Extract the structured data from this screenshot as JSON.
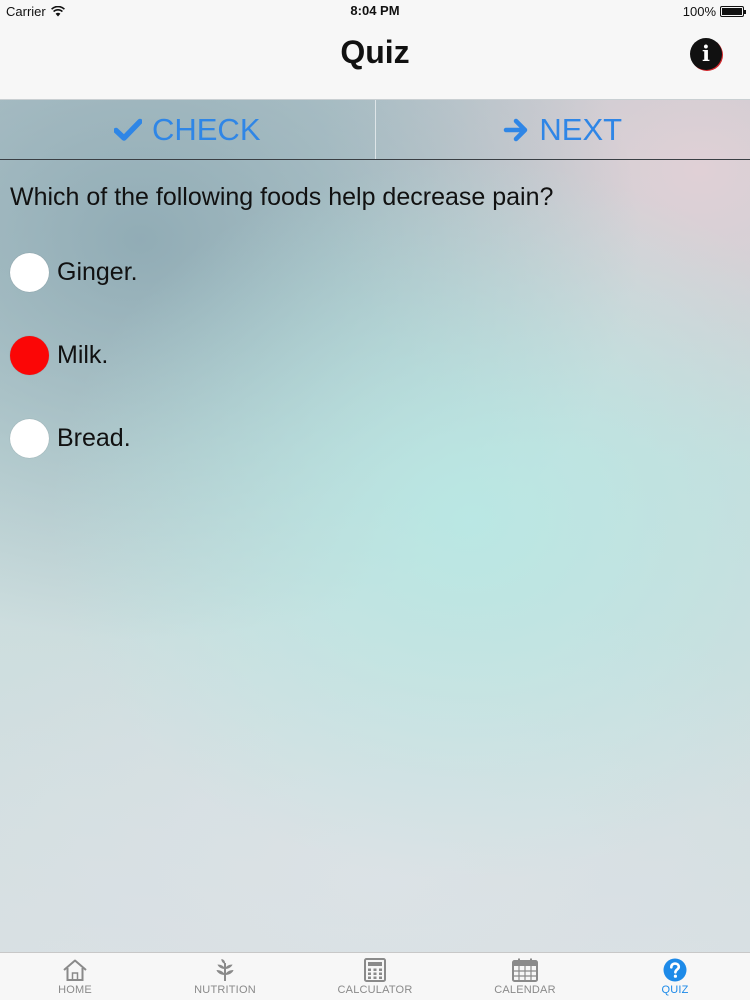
{
  "status_bar": {
    "carrier": "Carrier",
    "time": "8:04 PM",
    "battery": "100%",
    "battery_level": 1.0
  },
  "nav": {
    "title": "Quiz",
    "info_icon": "info-icon"
  },
  "actions": {
    "check_label": "CHECK",
    "next_label": "NEXT",
    "accent_color": "#2f86e6"
  },
  "quiz": {
    "question": "Which of the following foods help decrease pain?",
    "options": [
      {
        "label": "Ginger.",
        "selected": false
      },
      {
        "label": "Milk.",
        "selected": true
      },
      {
        "label": "Bread.",
        "selected": false
      }
    ],
    "selected_color": "#fb0606"
  },
  "tabs": [
    {
      "label": "HOME",
      "icon": "home-icon",
      "active": false
    },
    {
      "label": "NUTRITION",
      "icon": "plant-icon",
      "active": false
    },
    {
      "label": "CALCULATOR",
      "icon": "calculator-icon",
      "active": false
    },
    {
      "label": "CALENDAR",
      "icon": "calendar-icon",
      "active": false
    },
    {
      "label": "QUIZ",
      "icon": "question-icon",
      "active": true
    }
  ]
}
